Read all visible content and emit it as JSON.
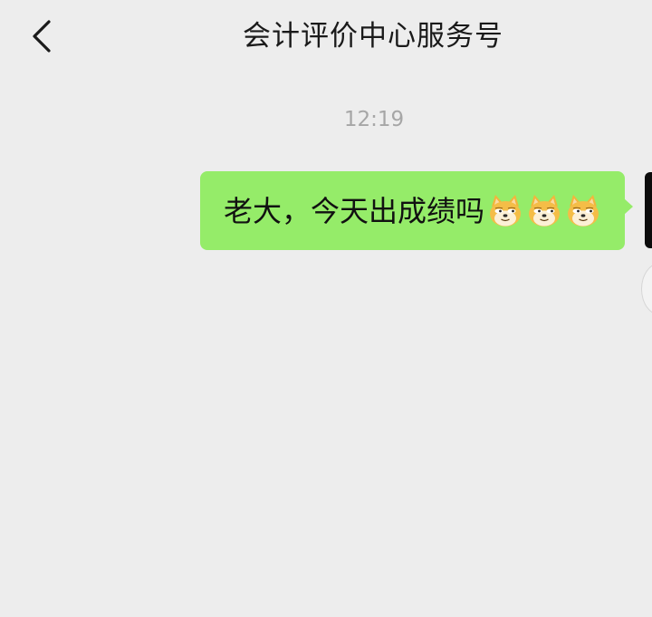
{
  "header": {
    "title": "会计评价中心服务号",
    "back_icon": "chevron-left-icon"
  },
  "chat": {
    "timestamp": "12:19",
    "messages": [
      {
        "sender": "me",
        "text": "老大，今天出成绩吗",
        "emojis": [
          "doge-emoji",
          "doge-emoji",
          "doge-emoji"
        ]
      }
    ]
  },
  "colors": {
    "background": "#ededed",
    "bubble_green": "#95ec69",
    "timestamp_gray": "#a6a6a6",
    "title_text": "#1a1a1a"
  }
}
